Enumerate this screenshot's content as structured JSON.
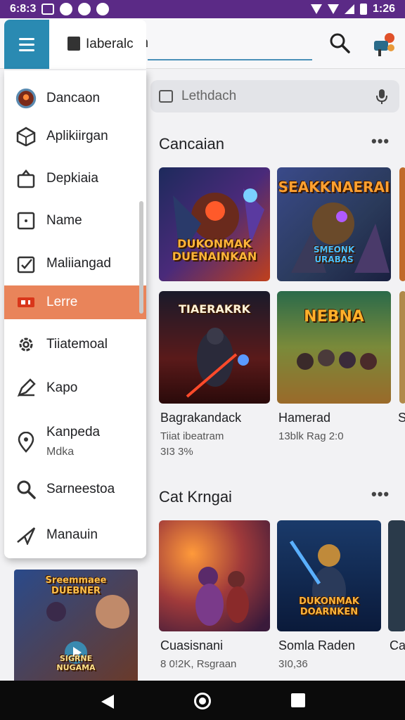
{
  "status_bar": {
    "time_left": "6:8:3",
    "time_right": "1:26"
  },
  "app_bar": {
    "title_tail": "n"
  },
  "search": {
    "placeholder": "Lethdach"
  },
  "drawer": {
    "header_label": "Iaberalc",
    "items": [
      {
        "label": "Dancaon",
        "icon": "avatar-icon"
      },
      {
        "label": "Aplikiirgan",
        "icon": "cube-icon"
      },
      {
        "label": "Depkiaia",
        "icon": "bag-icon"
      },
      {
        "label": "Name",
        "icon": "square-icon"
      },
      {
        "label": "Maliiangad",
        "icon": "clipboard-icon"
      },
      {
        "label": "Lerre",
        "icon": "ticket-icon",
        "active": true
      },
      {
        "label": "Tiiatemoal",
        "icon": "gear-icon"
      },
      {
        "label": "Kapo",
        "icon": "pen-icon"
      },
      {
        "label": "Kanpeda",
        "sub": "Mdka",
        "icon": "location-icon"
      },
      {
        "label": "Sarneestoa",
        "icon": "search-icon"
      },
      {
        "label": "Manauin",
        "icon": "send-icon"
      }
    ]
  },
  "section1": {
    "title": "Cancaian",
    "more": "•••",
    "cards": [
      {
        "art_text": "DUKONMAK\nDUENAINKAN"
      },
      {
        "art_text": "SEAKKNAERAI",
        "art_text2": "SMEONK\nURABAS"
      }
    ]
  },
  "section1_row2": {
    "cards": [
      {
        "art_text": "TIAERAKRK",
        "title": "Bagrakandack",
        "sub": "Tiiat ibeatram",
        "sub2": "3I3 3%"
      },
      {
        "art_text": "NEBNA",
        "title": "Hamerad",
        "sub": "13blk Rag 2:0"
      }
    ],
    "peek_title": "S"
  },
  "section2": {
    "title": "Cat Krngai",
    "more": "•••",
    "cards": [
      {
        "title": "Cuasisnani",
        "sub": "8 0!2K, Rsgraan"
      },
      {
        "art_text": "DUKONMAK\nDOARNKEN",
        "title": "Somla Raden",
        "sub": "3I0,36"
      }
    ],
    "peek_title": "Ca"
  },
  "promo": {
    "art_text": "Sreemmaee\nDUEBNER",
    "art_text2": "SIGRNE\nNUGAMA"
  }
}
